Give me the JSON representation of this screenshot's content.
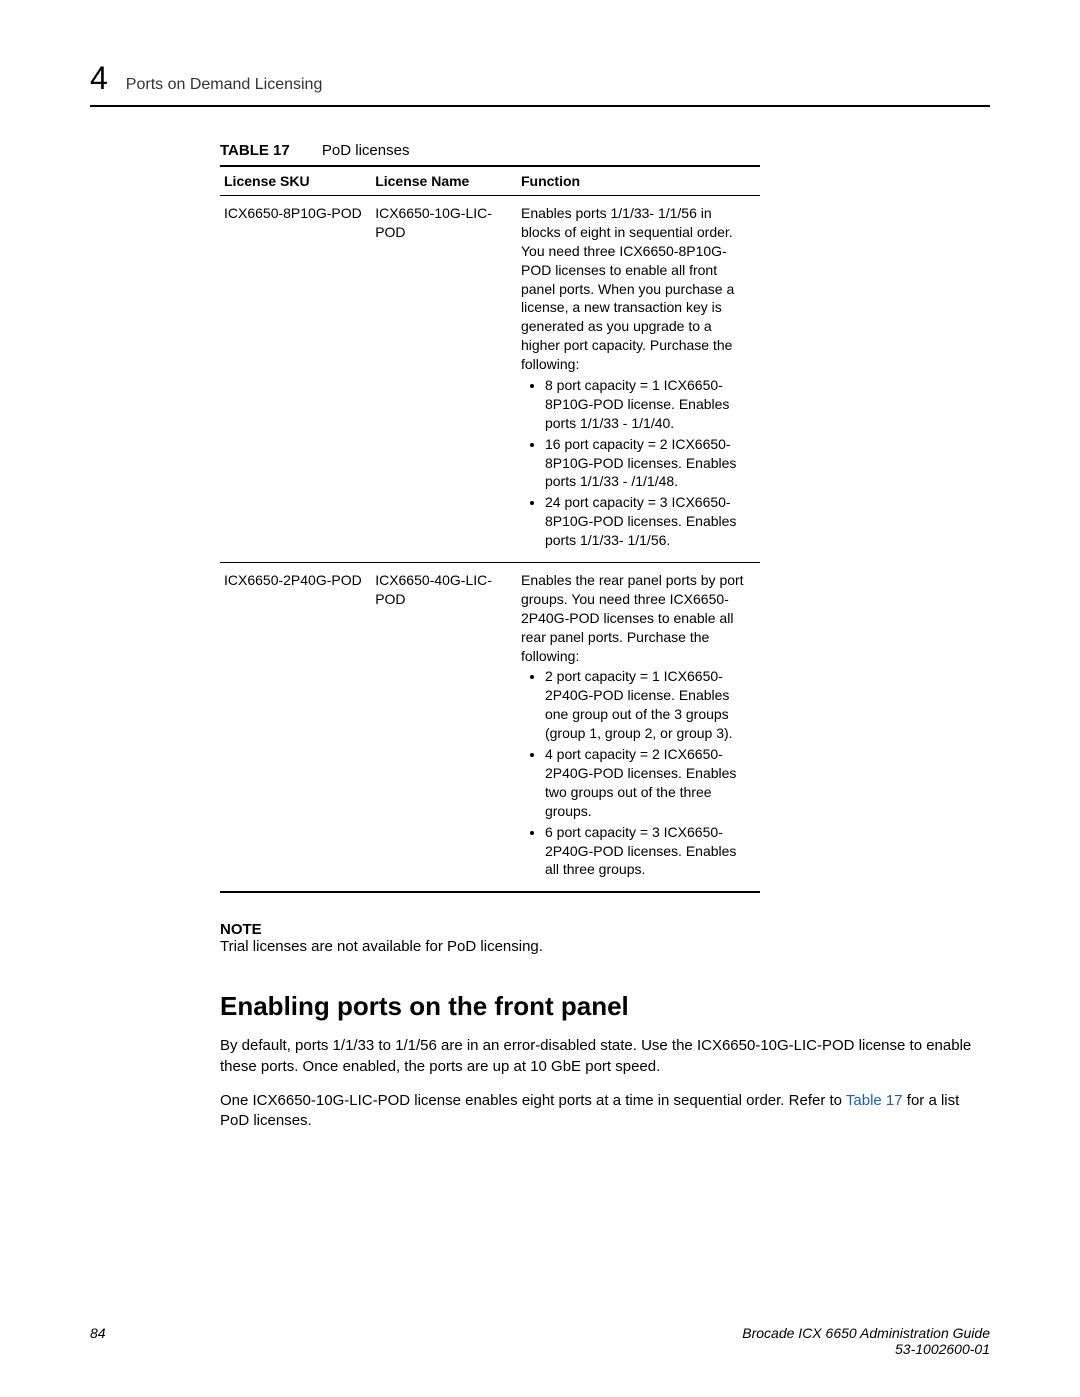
{
  "header": {
    "chapter_number": "4",
    "chapter_title": "Ports on Demand Licensing"
  },
  "table": {
    "number": "TABLE 17",
    "title": "PoD licenses",
    "columns": [
      "License SKU",
      "License Name",
      "Function"
    ],
    "rows": [
      {
        "sku": "ICX6650-8P10G-POD",
        "name": "ICX6650-10G-LIC-POD",
        "func_intro": "Enables ports 1/1/33- 1/1/56 in blocks of eight in sequential order. You need three ICX6650-8P10G-POD licenses to enable all front panel ports. When you purchase a license, a new transaction key is generated as you upgrade to a higher port capacity. Purchase the following:",
        "bullets": [
          "8 port capacity = 1 ICX6650-8P10G-POD license. Enables ports 1/1/33 - 1/1/40.",
          "16 port capacity = 2 ICX6650-8P10G-POD licenses. Enables ports 1/1/33 - /1/1/48.",
          "24 port capacity = 3 ICX6650-8P10G-POD licenses. Enables ports 1/1/33- 1/1/56."
        ]
      },
      {
        "sku": "ICX6650-2P40G-POD",
        "name": "ICX6650-40G-LIC-POD",
        "func_intro": "Enables the rear panel ports by port groups. You need three ICX6650-2P40G-POD licenses to enable all rear panel ports. Purchase the following:",
        "bullets": [
          "2 port capacity = 1 ICX6650-2P40G-POD license. Enables one group out of the 3 groups (group 1, group 2, or group 3).",
          "4 port capacity = 2 ICX6650-2P40G-POD licenses. Enables two groups out of the three groups.",
          "6 port capacity = 3 ICX6650-2P40G-POD licenses. Enables all three groups."
        ]
      }
    ]
  },
  "note": {
    "label": "NOTE",
    "text": "Trial licenses are not available for PoD licensing."
  },
  "section": {
    "heading": "Enabling ports on the front panel",
    "para1": "By default, ports 1/1/33 to 1/1/56 are in an error-disabled state. Use the ICX6650-10G-LIC-POD license to enable these ports. Once enabled, the ports are up at 10 GbE port speed.",
    "para2_pre": "One ICX6650-10G-LIC-POD license enables eight ports at a time in sequential order. Refer to ",
    "para2_link": "Table 17",
    "para2_post": " for a list PoD licenses."
  },
  "footer": {
    "page_number": "84",
    "doc_title": "Brocade ICX 6650 Administration Guide",
    "doc_id": "53-1002600-01"
  }
}
